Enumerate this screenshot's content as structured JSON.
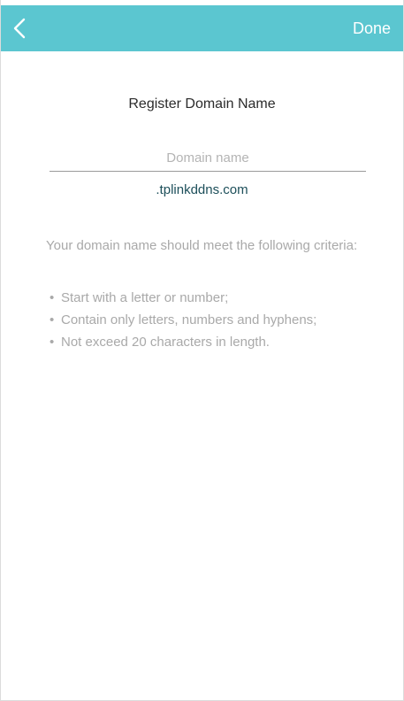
{
  "header": {
    "back_icon": "chevron-left-icon",
    "done_label": "Done",
    "background_color": "#5bc6d0"
  },
  "form": {
    "title": "Register Domain Name",
    "domain_input": {
      "value": "",
      "placeholder": "Domain name"
    },
    "domain_suffix": ".tplinkddns.com"
  },
  "criteria": {
    "intro": "Your domain name should meet the following criteria:",
    "items": [
      "Start with a letter or number;",
      "Contain only letters, numbers and hyphens;",
      "Not exceed 20 characters in length."
    ]
  }
}
